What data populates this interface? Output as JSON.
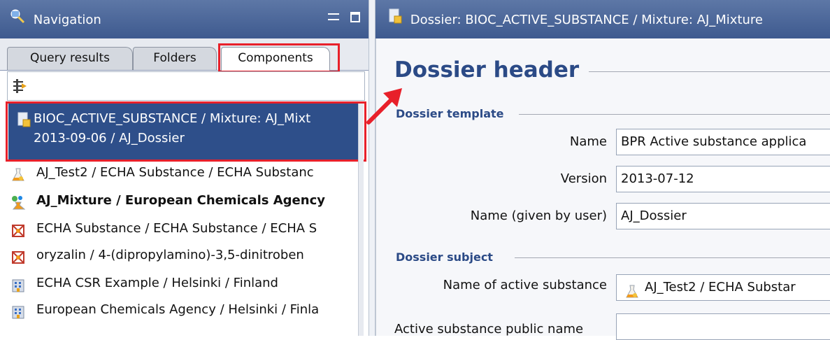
{
  "navigation": {
    "title": "Navigation",
    "tabs": [
      {
        "label": "Query results"
      },
      {
        "label": "Folders"
      },
      {
        "label": "Components"
      }
    ],
    "selected_item": {
      "line1": "BIOC_ACTIVE_SUBSTANCE / Mixture: AJ_Mixt",
      "line2": "2013-09-06 / AJ_Dossier"
    },
    "items": [
      {
        "label": "AJ_Test2 / ECHA Substance / ECHA Substanc",
        "icon": "flask-icon"
      },
      {
        "label": "AJ_Mixture / European Chemicals Agency",
        "icon": "mixture-icon"
      },
      {
        "label": "ECHA Substance / ECHA Substance / ECHA S",
        "icon": "molecule-icon"
      },
      {
        "label": "oryzalin / 4-(dipropylamino)-3,5-dinitroben",
        "icon": "molecule-icon"
      },
      {
        "label": "ECHA CSR Example / Helsinki / Finland",
        "icon": "building-icon"
      },
      {
        "label": "European Chemicals Agency / Helsinki / Finla",
        "icon": "building-icon"
      }
    ]
  },
  "editor": {
    "title": "Dossier: BIOC_ACTIVE_SUBSTANCE / Mixture: AJ_Mixture",
    "header": "Dossier header",
    "template_section": "Dossier template",
    "fields": {
      "name_label": "Name",
      "name_value": "BPR Active substance applica",
      "version_label": "Version",
      "version_value": "2013-07-12",
      "user_name_label": "Name (given by user)",
      "user_name_value": "AJ_Dossier"
    },
    "subject_section": "Dossier subject",
    "subject": {
      "active_label": "Name of active substance",
      "active_value": "AJ_Test2 / ECHA Substar",
      "public_label": "Active substance public name",
      "public_value": ""
    }
  },
  "colors": {
    "titlebar": "#4a6698",
    "selection": "#2e4f8a",
    "heading": "#2b4a86",
    "annotation": "#e8202a"
  }
}
